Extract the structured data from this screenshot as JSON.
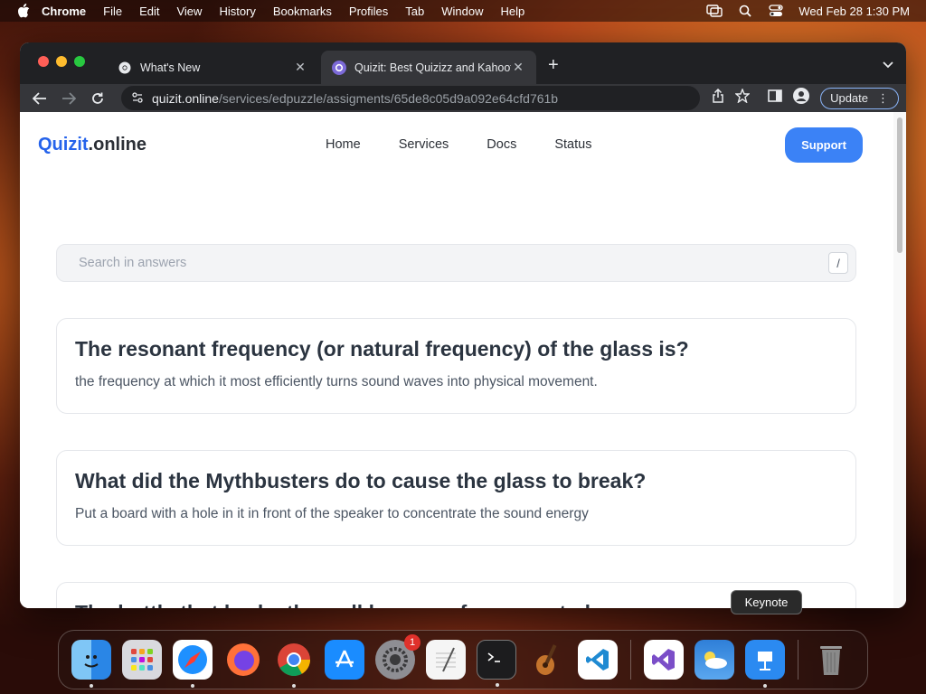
{
  "menubar": {
    "app": "Chrome",
    "items": [
      "File",
      "Edit",
      "View",
      "History",
      "Bookmarks",
      "Profiles",
      "Tab",
      "Window",
      "Help"
    ],
    "clock": "Wed Feb 28  1:30 PM"
  },
  "browser": {
    "tabs": [
      {
        "title": "What's New",
        "active": false
      },
      {
        "title": "Quizit: Best Quizizz and Kahoot",
        "active": true
      }
    ],
    "url_host": "quizit.online",
    "url_path": "/services/edpuzzle/assigments/65de8c05d9a092e64cfd761b",
    "update_label": "Update"
  },
  "site": {
    "logo_main": "Quizit",
    "logo_accent": ".online",
    "nav": [
      "Home",
      "Services",
      "Docs",
      "Status"
    ],
    "support_label": "Support",
    "search_placeholder": "Search in answers",
    "search_shortcut": "/",
    "cards": [
      {
        "question": "The resonant frequency (or natural frequency) of the glass is?",
        "answer": " the frequency at which it most efficiently turns sound waves into physical movement."
      },
      {
        "question": "What did the Mythbusters do to cause the glass to break?",
        "answer": "Put a board with a hole in it in front of the speaker to concentrate the sound energy"
      },
      {
        "question": "The bottle that broke the wall has a performance to have",
        "answer": ""
      }
    ]
  },
  "dock": {
    "tooltip": "Keynote",
    "settings_badge": "1",
    "apps": [
      "finder-icon",
      "launchpad-icon",
      "safari-icon",
      "firefox-icon",
      "chrome-icon",
      "app-store-icon",
      "system-settings-icon",
      "textedit-icon",
      "terminal-icon",
      "garageband-icon",
      "vscode-icon",
      "visual-studio-icon",
      "weather-icon",
      "keynote-icon",
      "trash-icon"
    ]
  }
}
